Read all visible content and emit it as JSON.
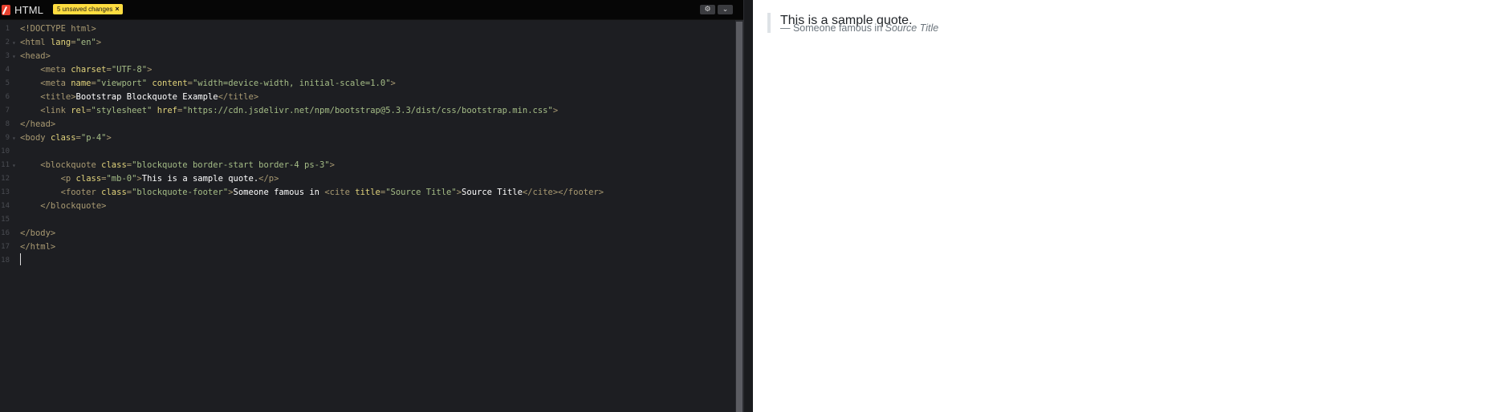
{
  "editor": {
    "title": "HTML",
    "unsaved_badge": "5 unsaved changes",
    "unsaved_close": "×",
    "settings_icon": "gear-icon",
    "collapse_icon": "chevron-down-icon"
  },
  "lines": [
    {
      "n": "1",
      "tokens": [
        [
          "tag",
          "<!DOCTYPE html>"
        ]
      ]
    },
    {
      "n": "2",
      "fold": true,
      "tokens": [
        [
          "tag",
          "<html "
        ],
        [
          "attr",
          "lang"
        ],
        [
          "tag",
          "="
        ],
        [
          "str",
          "\"en\""
        ],
        [
          "tag",
          ">"
        ]
      ]
    },
    {
      "n": "3",
      "fold": true,
      "tokens": [
        [
          "tag",
          "<head>"
        ]
      ]
    },
    {
      "n": "4",
      "tokens": [
        [
          "tag",
          "    <meta "
        ],
        [
          "attr",
          "charset"
        ],
        [
          "tag",
          "="
        ],
        [
          "str",
          "\"UTF-8\""
        ],
        [
          "tag",
          ">"
        ]
      ]
    },
    {
      "n": "5",
      "tokens": [
        [
          "tag",
          "    <meta "
        ],
        [
          "attr",
          "name"
        ],
        [
          "tag",
          "="
        ],
        [
          "str",
          "\"viewport\""
        ],
        [
          "tag",
          " "
        ],
        [
          "attr",
          "content"
        ],
        [
          "tag",
          "="
        ],
        [
          "str",
          "\"width=device-width, initial-scale=1.0\""
        ],
        [
          "tag",
          ">"
        ]
      ]
    },
    {
      "n": "6",
      "tokens": [
        [
          "tag",
          "    <title>"
        ],
        [
          "plain",
          "Bootstrap Blockquote Example"
        ],
        [
          "tag",
          "</title>"
        ]
      ]
    },
    {
      "n": "7",
      "tokens": [
        [
          "tag",
          "    <link "
        ],
        [
          "attr",
          "rel"
        ],
        [
          "tag",
          "="
        ],
        [
          "str",
          "\"stylesheet\""
        ],
        [
          "tag",
          " "
        ],
        [
          "attr",
          "href"
        ],
        [
          "tag",
          "="
        ],
        [
          "str",
          "\"https://cdn.jsdelivr.net/npm/bootstrap@5.3.3/dist/css/bootstrap.min.css\""
        ],
        [
          "tag",
          ">"
        ]
      ]
    },
    {
      "n": "8",
      "tokens": [
        [
          "tag",
          "</head>"
        ]
      ]
    },
    {
      "n": "9",
      "fold": true,
      "tokens": [
        [
          "tag",
          "<body "
        ],
        [
          "attr",
          "class"
        ],
        [
          "tag",
          "="
        ],
        [
          "str",
          "\"p-4\""
        ],
        [
          "tag",
          ">"
        ]
      ]
    },
    {
      "n": "10",
      "tokens": []
    },
    {
      "n": "11",
      "fold": true,
      "tokens": [
        [
          "tag",
          "    <blockquote "
        ],
        [
          "attr",
          "class"
        ],
        [
          "tag",
          "="
        ],
        [
          "str",
          "\"blockquote border-start border-4 ps-3\""
        ],
        [
          "tag",
          ">"
        ]
      ]
    },
    {
      "n": "12",
      "tokens": [
        [
          "tag",
          "        <p "
        ],
        [
          "attr",
          "class"
        ],
        [
          "tag",
          "="
        ],
        [
          "str",
          "\"mb-0\""
        ],
        [
          "tag",
          ">"
        ],
        [
          "plain",
          "This is a sample quote."
        ],
        [
          "tag",
          "</p>"
        ]
      ]
    },
    {
      "n": "13",
      "tokens": [
        [
          "tag",
          "        <footer "
        ],
        [
          "attr",
          "class"
        ],
        [
          "tag",
          "="
        ],
        [
          "str",
          "\"blockquote-footer\""
        ],
        [
          "tag",
          ">"
        ],
        [
          "plain",
          "Someone famous in "
        ],
        [
          "tag",
          "<cite "
        ],
        [
          "attr",
          "title"
        ],
        [
          "tag",
          "="
        ],
        [
          "str",
          "\"Source Title\""
        ],
        [
          "tag",
          ">"
        ],
        [
          "plain",
          "Source Title"
        ],
        [
          "tag",
          "</cite></footer>"
        ]
      ]
    },
    {
      "n": "14",
      "tokens": [
        [
          "tag",
          "    </blockquote>"
        ]
      ]
    },
    {
      "n": "15",
      "tokens": []
    },
    {
      "n": "16",
      "tokens": [
        [
          "tag",
          "</body>"
        ]
      ]
    },
    {
      "n": "17",
      "tokens": [
        [
          "tag",
          "</html>"
        ]
      ]
    },
    {
      "n": "18",
      "tokens": []
    }
  ],
  "preview": {
    "quote_text": "This is a sample quote.",
    "footer_text": "— Someone famous in ",
    "cite_text": "Source Title"
  }
}
